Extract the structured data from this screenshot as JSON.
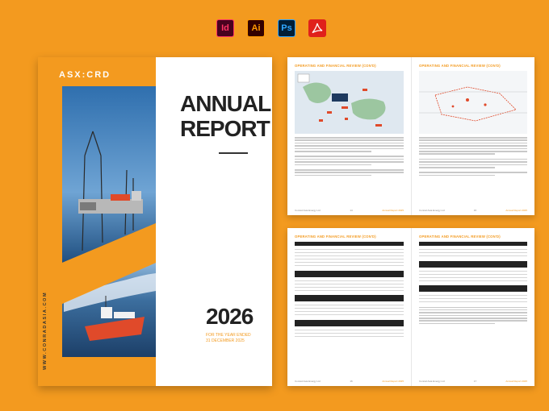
{
  "software_icons": [
    {
      "name": "indesign-icon",
      "label": "Id"
    },
    {
      "name": "illustrator-icon",
      "label": "Ai"
    },
    {
      "name": "photoshop-icon",
      "label": "Ps"
    },
    {
      "name": "acrobat-pdf-icon",
      "label": "⏣"
    }
  ],
  "cover": {
    "brand": "ASX:CRD",
    "title_line1": "ANNUAL",
    "title_line2": "REPORT",
    "year": "2026",
    "subtitle_line1": "FOR THE YEAR ENDED",
    "subtitle_line2": "31 DECEMBER 2025",
    "website": "WWW.CONRADASIA.COM"
  },
  "spreads": {
    "top_left_header": "OPERATING AND FINANCIAL REVIEW (CON'D)",
    "top_right_header": "OPERATING AND FINANCIAL REVIEW (CON'D)",
    "bottom_left_header": "OPERATING AND FINANCIAL REVIEW (CON'D)",
    "bottom_right_header": "OPERATING AND FINANCIAL REVIEW (CON'D)",
    "footer_left": "Conrad Asia Energy Ltd",
    "footer_mid": "Annual Report 2025",
    "footer_page_a": "14",
    "footer_page_b": "15",
    "footer_page_c": "16",
    "footer_page_d": "17"
  },
  "colors": {
    "background": "#f39a1f",
    "accent": "#f39a1f",
    "dark": "#222222"
  }
}
